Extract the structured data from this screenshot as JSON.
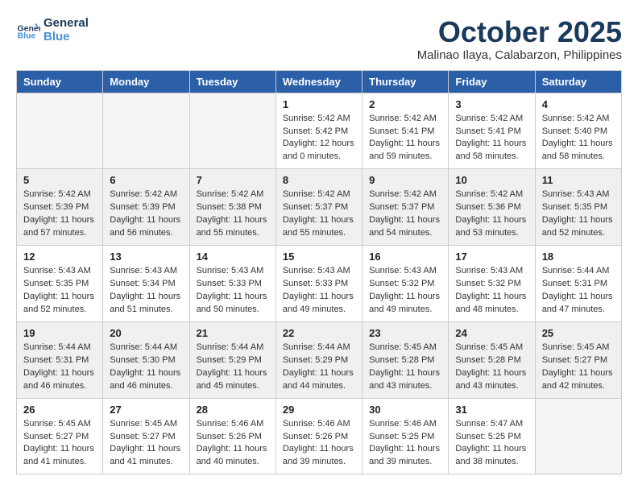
{
  "logo": {
    "line1": "General",
    "line2": "Blue"
  },
  "title": "October 2025",
  "location": "Malinao Ilaya, Calabarzon, Philippines",
  "weekdays": [
    "Sunday",
    "Monday",
    "Tuesday",
    "Wednesday",
    "Thursday",
    "Friday",
    "Saturday"
  ],
  "weeks": [
    [
      {
        "day": "",
        "info": ""
      },
      {
        "day": "",
        "info": ""
      },
      {
        "day": "",
        "info": ""
      },
      {
        "day": "1",
        "info": "Sunrise: 5:42 AM\nSunset: 5:42 PM\nDaylight: 12 hours\nand 0 minutes."
      },
      {
        "day": "2",
        "info": "Sunrise: 5:42 AM\nSunset: 5:41 PM\nDaylight: 11 hours\nand 59 minutes."
      },
      {
        "day": "3",
        "info": "Sunrise: 5:42 AM\nSunset: 5:41 PM\nDaylight: 11 hours\nand 58 minutes."
      },
      {
        "day": "4",
        "info": "Sunrise: 5:42 AM\nSunset: 5:40 PM\nDaylight: 11 hours\nand 58 minutes."
      }
    ],
    [
      {
        "day": "5",
        "info": "Sunrise: 5:42 AM\nSunset: 5:39 PM\nDaylight: 11 hours\nand 57 minutes."
      },
      {
        "day": "6",
        "info": "Sunrise: 5:42 AM\nSunset: 5:39 PM\nDaylight: 11 hours\nand 56 minutes."
      },
      {
        "day": "7",
        "info": "Sunrise: 5:42 AM\nSunset: 5:38 PM\nDaylight: 11 hours\nand 55 minutes."
      },
      {
        "day": "8",
        "info": "Sunrise: 5:42 AM\nSunset: 5:37 PM\nDaylight: 11 hours\nand 55 minutes."
      },
      {
        "day": "9",
        "info": "Sunrise: 5:42 AM\nSunset: 5:37 PM\nDaylight: 11 hours\nand 54 minutes."
      },
      {
        "day": "10",
        "info": "Sunrise: 5:42 AM\nSunset: 5:36 PM\nDaylight: 11 hours\nand 53 minutes."
      },
      {
        "day": "11",
        "info": "Sunrise: 5:43 AM\nSunset: 5:35 PM\nDaylight: 11 hours\nand 52 minutes."
      }
    ],
    [
      {
        "day": "12",
        "info": "Sunrise: 5:43 AM\nSunset: 5:35 PM\nDaylight: 11 hours\nand 52 minutes."
      },
      {
        "day": "13",
        "info": "Sunrise: 5:43 AM\nSunset: 5:34 PM\nDaylight: 11 hours\nand 51 minutes."
      },
      {
        "day": "14",
        "info": "Sunrise: 5:43 AM\nSunset: 5:33 PM\nDaylight: 11 hours\nand 50 minutes."
      },
      {
        "day": "15",
        "info": "Sunrise: 5:43 AM\nSunset: 5:33 PM\nDaylight: 11 hours\nand 49 minutes."
      },
      {
        "day": "16",
        "info": "Sunrise: 5:43 AM\nSunset: 5:32 PM\nDaylight: 11 hours\nand 49 minutes."
      },
      {
        "day": "17",
        "info": "Sunrise: 5:43 AM\nSunset: 5:32 PM\nDaylight: 11 hours\nand 48 minutes."
      },
      {
        "day": "18",
        "info": "Sunrise: 5:44 AM\nSunset: 5:31 PM\nDaylight: 11 hours\nand 47 minutes."
      }
    ],
    [
      {
        "day": "19",
        "info": "Sunrise: 5:44 AM\nSunset: 5:31 PM\nDaylight: 11 hours\nand 46 minutes."
      },
      {
        "day": "20",
        "info": "Sunrise: 5:44 AM\nSunset: 5:30 PM\nDaylight: 11 hours\nand 46 minutes."
      },
      {
        "day": "21",
        "info": "Sunrise: 5:44 AM\nSunset: 5:29 PM\nDaylight: 11 hours\nand 45 minutes."
      },
      {
        "day": "22",
        "info": "Sunrise: 5:44 AM\nSunset: 5:29 PM\nDaylight: 11 hours\nand 44 minutes."
      },
      {
        "day": "23",
        "info": "Sunrise: 5:45 AM\nSunset: 5:28 PM\nDaylight: 11 hours\nand 43 minutes."
      },
      {
        "day": "24",
        "info": "Sunrise: 5:45 AM\nSunset: 5:28 PM\nDaylight: 11 hours\nand 43 minutes."
      },
      {
        "day": "25",
        "info": "Sunrise: 5:45 AM\nSunset: 5:27 PM\nDaylight: 11 hours\nand 42 minutes."
      }
    ],
    [
      {
        "day": "26",
        "info": "Sunrise: 5:45 AM\nSunset: 5:27 PM\nDaylight: 11 hours\nand 41 minutes."
      },
      {
        "day": "27",
        "info": "Sunrise: 5:45 AM\nSunset: 5:27 PM\nDaylight: 11 hours\nand 41 minutes."
      },
      {
        "day": "28",
        "info": "Sunrise: 5:46 AM\nSunset: 5:26 PM\nDaylight: 11 hours\nand 40 minutes."
      },
      {
        "day": "29",
        "info": "Sunrise: 5:46 AM\nSunset: 5:26 PM\nDaylight: 11 hours\nand 39 minutes."
      },
      {
        "day": "30",
        "info": "Sunrise: 5:46 AM\nSunset: 5:25 PM\nDaylight: 11 hours\nand 39 minutes."
      },
      {
        "day": "31",
        "info": "Sunrise: 5:47 AM\nSunset: 5:25 PM\nDaylight: 11 hours\nand 38 minutes."
      },
      {
        "day": "",
        "info": ""
      }
    ]
  ]
}
